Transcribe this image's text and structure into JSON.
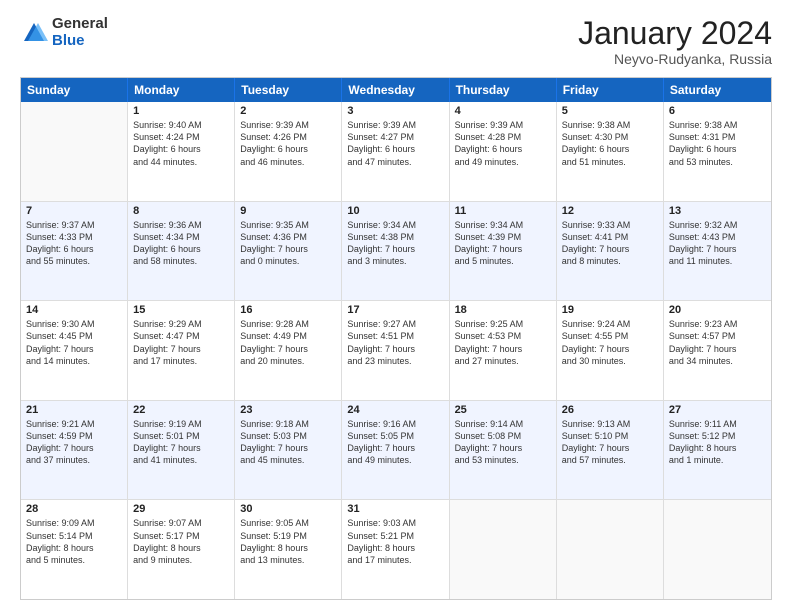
{
  "logo": {
    "general": "General",
    "blue": "Blue"
  },
  "title": {
    "month": "January 2024",
    "location": "Neyvo-Rudyanka, Russia"
  },
  "header_days": [
    "Sunday",
    "Monday",
    "Tuesday",
    "Wednesday",
    "Thursday",
    "Friday",
    "Saturday"
  ],
  "weeks": [
    {
      "alt": false,
      "cells": [
        {
          "day": "",
          "lines": []
        },
        {
          "day": "1",
          "lines": [
            "Sunrise: 9:40 AM",
            "Sunset: 4:24 PM",
            "Daylight: 6 hours",
            "and 44 minutes."
          ]
        },
        {
          "day": "2",
          "lines": [
            "Sunrise: 9:39 AM",
            "Sunset: 4:26 PM",
            "Daylight: 6 hours",
            "and 46 minutes."
          ]
        },
        {
          "day": "3",
          "lines": [
            "Sunrise: 9:39 AM",
            "Sunset: 4:27 PM",
            "Daylight: 6 hours",
            "and 47 minutes."
          ]
        },
        {
          "day": "4",
          "lines": [
            "Sunrise: 9:39 AM",
            "Sunset: 4:28 PM",
            "Daylight: 6 hours",
            "and 49 minutes."
          ]
        },
        {
          "day": "5",
          "lines": [
            "Sunrise: 9:38 AM",
            "Sunset: 4:30 PM",
            "Daylight: 6 hours",
            "and 51 minutes."
          ]
        },
        {
          "day": "6",
          "lines": [
            "Sunrise: 9:38 AM",
            "Sunset: 4:31 PM",
            "Daylight: 6 hours",
            "and 53 minutes."
          ]
        }
      ]
    },
    {
      "alt": true,
      "cells": [
        {
          "day": "7",
          "lines": [
            "Sunrise: 9:37 AM",
            "Sunset: 4:33 PM",
            "Daylight: 6 hours",
            "and 55 minutes."
          ]
        },
        {
          "day": "8",
          "lines": [
            "Sunrise: 9:36 AM",
            "Sunset: 4:34 PM",
            "Daylight: 6 hours",
            "and 58 minutes."
          ]
        },
        {
          "day": "9",
          "lines": [
            "Sunrise: 9:35 AM",
            "Sunset: 4:36 PM",
            "Daylight: 7 hours",
            "and 0 minutes."
          ]
        },
        {
          "day": "10",
          "lines": [
            "Sunrise: 9:34 AM",
            "Sunset: 4:38 PM",
            "Daylight: 7 hours",
            "and 3 minutes."
          ]
        },
        {
          "day": "11",
          "lines": [
            "Sunrise: 9:34 AM",
            "Sunset: 4:39 PM",
            "Daylight: 7 hours",
            "and 5 minutes."
          ]
        },
        {
          "day": "12",
          "lines": [
            "Sunrise: 9:33 AM",
            "Sunset: 4:41 PM",
            "Daylight: 7 hours",
            "and 8 minutes."
          ]
        },
        {
          "day": "13",
          "lines": [
            "Sunrise: 9:32 AM",
            "Sunset: 4:43 PM",
            "Daylight: 7 hours",
            "and 11 minutes."
          ]
        }
      ]
    },
    {
      "alt": false,
      "cells": [
        {
          "day": "14",
          "lines": [
            "Sunrise: 9:30 AM",
            "Sunset: 4:45 PM",
            "Daylight: 7 hours",
            "and 14 minutes."
          ]
        },
        {
          "day": "15",
          "lines": [
            "Sunrise: 9:29 AM",
            "Sunset: 4:47 PM",
            "Daylight: 7 hours",
            "and 17 minutes."
          ]
        },
        {
          "day": "16",
          "lines": [
            "Sunrise: 9:28 AM",
            "Sunset: 4:49 PM",
            "Daylight: 7 hours",
            "and 20 minutes."
          ]
        },
        {
          "day": "17",
          "lines": [
            "Sunrise: 9:27 AM",
            "Sunset: 4:51 PM",
            "Daylight: 7 hours",
            "and 23 minutes."
          ]
        },
        {
          "day": "18",
          "lines": [
            "Sunrise: 9:25 AM",
            "Sunset: 4:53 PM",
            "Daylight: 7 hours",
            "and 27 minutes."
          ]
        },
        {
          "day": "19",
          "lines": [
            "Sunrise: 9:24 AM",
            "Sunset: 4:55 PM",
            "Daylight: 7 hours",
            "and 30 minutes."
          ]
        },
        {
          "day": "20",
          "lines": [
            "Sunrise: 9:23 AM",
            "Sunset: 4:57 PM",
            "Daylight: 7 hours",
            "and 34 minutes."
          ]
        }
      ]
    },
    {
      "alt": true,
      "cells": [
        {
          "day": "21",
          "lines": [
            "Sunrise: 9:21 AM",
            "Sunset: 4:59 PM",
            "Daylight: 7 hours",
            "and 37 minutes."
          ]
        },
        {
          "day": "22",
          "lines": [
            "Sunrise: 9:19 AM",
            "Sunset: 5:01 PM",
            "Daylight: 7 hours",
            "and 41 minutes."
          ]
        },
        {
          "day": "23",
          "lines": [
            "Sunrise: 9:18 AM",
            "Sunset: 5:03 PM",
            "Daylight: 7 hours",
            "and 45 minutes."
          ]
        },
        {
          "day": "24",
          "lines": [
            "Sunrise: 9:16 AM",
            "Sunset: 5:05 PM",
            "Daylight: 7 hours",
            "and 49 minutes."
          ]
        },
        {
          "day": "25",
          "lines": [
            "Sunrise: 9:14 AM",
            "Sunset: 5:08 PM",
            "Daylight: 7 hours",
            "and 53 minutes."
          ]
        },
        {
          "day": "26",
          "lines": [
            "Sunrise: 9:13 AM",
            "Sunset: 5:10 PM",
            "Daylight: 7 hours",
            "and 57 minutes."
          ]
        },
        {
          "day": "27",
          "lines": [
            "Sunrise: 9:11 AM",
            "Sunset: 5:12 PM",
            "Daylight: 8 hours",
            "and 1 minute."
          ]
        }
      ]
    },
    {
      "alt": false,
      "cells": [
        {
          "day": "28",
          "lines": [
            "Sunrise: 9:09 AM",
            "Sunset: 5:14 PM",
            "Daylight: 8 hours",
            "and 5 minutes."
          ]
        },
        {
          "day": "29",
          "lines": [
            "Sunrise: 9:07 AM",
            "Sunset: 5:17 PM",
            "Daylight: 8 hours",
            "and 9 minutes."
          ]
        },
        {
          "day": "30",
          "lines": [
            "Sunrise: 9:05 AM",
            "Sunset: 5:19 PM",
            "Daylight: 8 hours",
            "and 13 minutes."
          ]
        },
        {
          "day": "31",
          "lines": [
            "Sunrise: 9:03 AM",
            "Sunset: 5:21 PM",
            "Daylight: 8 hours",
            "and 17 minutes."
          ]
        },
        {
          "day": "",
          "lines": []
        },
        {
          "day": "",
          "lines": []
        },
        {
          "day": "",
          "lines": []
        }
      ]
    }
  ]
}
